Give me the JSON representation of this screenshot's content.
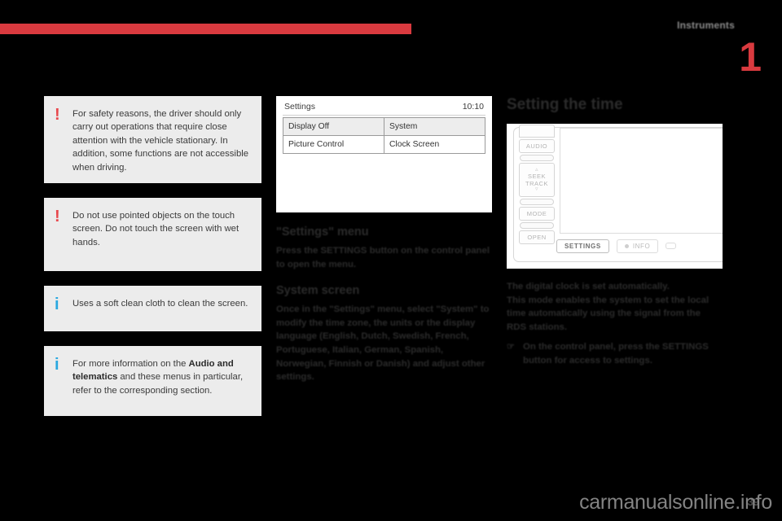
{
  "header": {
    "section_title": "Instruments",
    "chapter_number": "1",
    "rule_color": "#d93a3f"
  },
  "left_column": {
    "callouts": [
      {
        "icon": "warning-exclamation",
        "mark": "!",
        "type": "warning",
        "text": "For safety reasons, the driver should only carry out operations that require close attention with the vehicle stationary. In addition, some functions are not accessible when driving."
      },
      {
        "icon": "warning-exclamation",
        "mark": "!",
        "type": "warning",
        "text": "Do not use pointed objects on the touch screen. Do not touch the screen with wet hands."
      },
      {
        "icon": "information-i",
        "mark": "i",
        "type": "info",
        "text": "Uses a soft clean cloth to clean the screen."
      },
      {
        "icon": "information-i",
        "mark": "i",
        "type": "info",
        "text_before": "For more information on the ",
        "text_bold": "Audio and telematics",
        "text_after": " and these menus in particular, refer to the corresponding section."
      }
    ]
  },
  "middle_column": {
    "device_screen": {
      "title": "Settings",
      "clock": "10:10",
      "rows": [
        {
          "left": "Display Off",
          "right": "System"
        },
        {
          "left": "Picture Control",
          "right": "Clock Screen"
        }
      ]
    },
    "settings_section": {
      "heading": "\"Settings\" menu",
      "paragraph": "Press the SETTINGS button on the control panel to open the menu."
    },
    "system_section": {
      "heading": "System screen",
      "paragraph": "Once in the \"Settings\" menu, select \"System\" to modify the time zone, the units or the display language (English, Dutch, Swedish, French, Portuguese, Italian, German, Spanish, Norwegian, Finnish or Danish) and adjust other settings."
    }
  },
  "right_column": {
    "page_title": "Setting the time",
    "radio_panel": {
      "side_buttons": [
        "AUDIO",
        "SEEK",
        "TRACK",
        "MODE",
        "OPEN"
      ],
      "bottom_buttons": [
        "SETTINGS",
        "INFO",
        ""
      ]
    },
    "paragraph_1": "The digital clock is set automatically.",
    "paragraph_2": "This mode enables the system to set the local time automatically using the signal from the RDS stations.",
    "bullet": {
      "mark": "☞",
      "text": "On the control panel, press the SETTINGS button for access to settings."
    }
  },
  "footer": {
    "page_number": "39",
    "watermark": "carmanualsonline.info"
  }
}
